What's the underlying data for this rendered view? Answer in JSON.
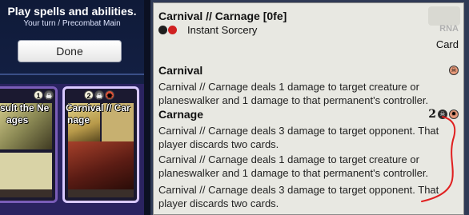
{
  "prompt": {
    "title": "Play spells and abilities.",
    "turn": "Your turn / Precombat Main",
    "done_label": "Done"
  },
  "hand_cards": [
    {
      "name_line1": "sult the Ne",
      "name_line2": "ages",
      "mana": [
        "1",
        "B"
      ]
    },
    {
      "name_line1": "Carnival // Car",
      "name_line2": "nage",
      "mana": [
        "2",
        "B",
        "R"
      ]
    }
  ],
  "detail": {
    "title": "Carnival // Carnage [0fe]",
    "mana_colors": [
      "black",
      "red"
    ],
    "type_line": "Instant Sorcery",
    "set_code": "RNA",
    "kind": "Card",
    "halves": [
      {
        "name": "Carnival",
        "cost": [
          "B/R"
        ],
        "text": "Carnival // Carnage deals 1 damage to target creature or planeswalker and 1 damage to that permanent's controller."
      },
      {
        "name": "Carnage",
        "cost_number": "2",
        "cost": [
          "B",
          "R"
        ],
        "text": "Carnival // Carnage deals 3 damage to target opponent. That player discards two cards."
      }
    ],
    "extra_text": [
      "Carnival // Carnage deals 1 damage to target creature or planeswalker and 1 damage to that permanent's controller.",
      "Carnival // Carnage deals 3 damage to target opponent. That player discards two cards."
    ]
  },
  "colors": {
    "panel_bg": "#e8e8e2",
    "annotation": "#e02020",
    "black_mana": "#1e1e1e",
    "red_mana": "#d02121"
  },
  "icons": {
    "black_mana": "skull-circle-icon",
    "red_mana": "flame-circle-icon",
    "hybrid_mana": "black-red-hybrid-icon"
  }
}
